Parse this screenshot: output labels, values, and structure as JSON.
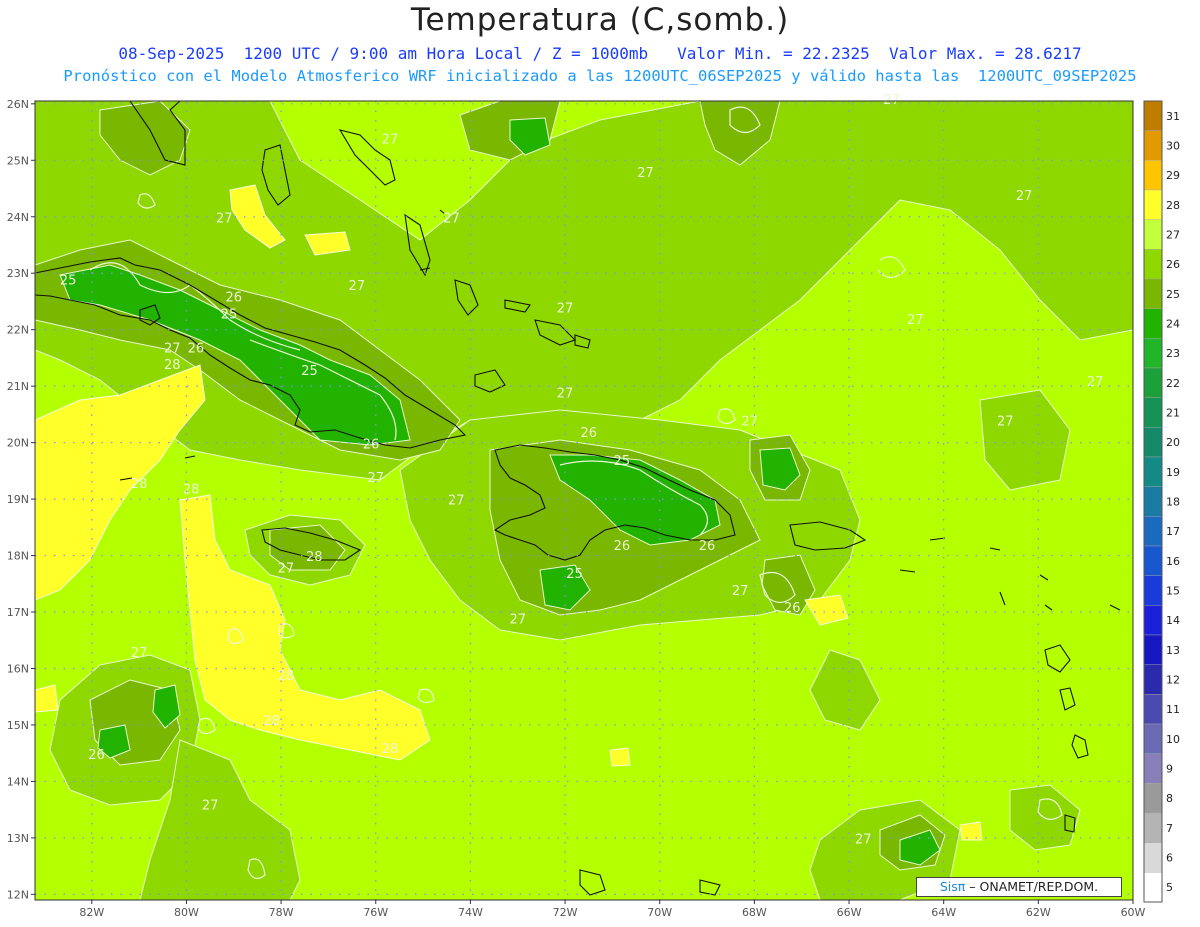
{
  "title": "Temperatura (C,somb.)",
  "subtitle_line1": "08-Sep-2025  1200 UTC / 9:00 am Hora Local / Z = 1000mb   Valor Min. = 22.2325  Valor Max. = 28.6217",
  "subtitle_line2": "Pronóstico con el Modelo Atmosferico WRF inicializado a las 1200UTC_06SEP2025 y válido hasta las  1200UTC_09SEP2025",
  "map": {
    "lat_ticks": [
      "26N",
      "25N",
      "24N",
      "23N",
      "22N",
      "21N",
      "20N",
      "19N",
      "18N",
      "17N",
      "16N",
      "15N",
      "14N",
      "13N",
      "12N"
    ],
    "lon_ticks": [
      "82W",
      "80W",
      "78W",
      "76W",
      "74W",
      "72W",
      "70W",
      "68W",
      "66W",
      "64W",
      "62W",
      "60W"
    ],
    "lat_values": [
      26,
      25,
      24,
      23,
      22,
      21,
      20,
      19,
      18,
      17,
      16,
      15,
      14,
      13,
      12
    ],
    "lon_values": [
      -82,
      -80,
      -78,
      -76,
      -74,
      -72,
      -70,
      -68,
      -66,
      -64,
      -62,
      -60
    ],
    "extent": {
      "lon_min": -83.2,
      "lon_max": -60,
      "lat_min": 11.9,
      "lat_max": 26.05
    },
    "contour_labels": [
      {
        "text": "25",
        "lon": -82.5,
        "lat": 22.8
      },
      {
        "text": "26",
        "lon": -79.0,
        "lat": 22.5
      },
      {
        "text": "25",
        "lon": -79.1,
        "lat": 22.2
      },
      {
        "text": "27",
        "lon": -76.4,
        "lat": 22.7
      },
      {
        "text": "27",
        "lon": -80.3,
        "lat": 21.6
      },
      {
        "text": "26",
        "lon": -79.8,
        "lat": 21.6
      },
      {
        "text": "28",
        "lon": -80.3,
        "lat": 21.3
      },
      {
        "text": "25",
        "lon": -77.4,
        "lat": 21.2
      },
      {
        "text": "26",
        "lon": -76.1,
        "lat": 19.9
      },
      {
        "text": "27",
        "lon": -76.0,
        "lat": 19.3
      },
      {
        "text": "28",
        "lon": -81.0,
        "lat": 19.2
      },
      {
        "text": "28",
        "lon": -79.9,
        "lat": 19.1
      },
      {
        "text": "27",
        "lon": -74.3,
        "lat": 18.9
      },
      {
        "text": "26",
        "lon": -71.5,
        "lat": 20.1
      },
      {
        "text": "25",
        "lon": -70.8,
        "lat": 19.6
      },
      {
        "text": "27",
        "lon": -72.0,
        "lat": 20.8
      },
      {
        "text": "27",
        "lon": -72.0,
        "lat": 22.3
      },
      {
        "text": "27",
        "lon": -74.4,
        "lat": 23.9
      },
      {
        "text": "27",
        "lon": -75.7,
        "lat": 25.3
      },
      {
        "text": "27",
        "lon": -70.3,
        "lat": 24.7
      },
      {
        "text": "27",
        "lon": -79.2,
        "lat": 23.9
      },
      {
        "text": "27",
        "lon": -65.1,
        "lat": 26.0
      },
      {
        "text": "27",
        "lon": -64.6,
        "lat": 22.1
      },
      {
        "text": "27",
        "lon": -62.3,
        "lat": 24.3
      },
      {
        "text": "27",
        "lon": -60.8,
        "lat": 21.0
      },
      {
        "text": "27",
        "lon": -62.7,
        "lat": 20.3
      },
      {
        "text": "27",
        "lon": -68.1,
        "lat": 20.3
      },
      {
        "text": "26",
        "lon": -70.8,
        "lat": 18.1
      },
      {
        "text": "26",
        "lon": -69.0,
        "lat": 18.1
      },
      {
        "text": "25",
        "lon": -71.8,
        "lat": 17.6
      },
      {
        "text": "27",
        "lon": -68.3,
        "lat": 17.3
      },
      {
        "text": "26",
        "lon": -67.2,
        "lat": 17.0
      },
      {
        "text": "27",
        "lon": -73.0,
        "lat": 16.8
      },
      {
        "text": "28",
        "lon": -77.3,
        "lat": 17.9
      },
      {
        "text": "27",
        "lon": -77.9,
        "lat": 17.7
      },
      {
        "text": "27",
        "lon": -81.0,
        "lat": 16.2
      },
      {
        "text": "28",
        "lon": -77.9,
        "lat": 15.8
      },
      {
        "text": "28",
        "lon": -78.2,
        "lat": 15.0
      },
      {
        "text": "28",
        "lon": -75.7,
        "lat": 14.5
      },
      {
        "text": "26",
        "lon": -81.9,
        "lat": 14.4
      },
      {
        "text": "27",
        "lon": -79.5,
        "lat": 13.5
      },
      {
        "text": "27",
        "lon": -65.7,
        "lat": 12.9
      }
    ]
  },
  "colorbar": {
    "levels": [
      "31",
      "30",
      "29",
      "28",
      "27",
      "26",
      "25",
      "24",
      "23",
      "22",
      "21",
      "20",
      "19",
      "18",
      "17",
      "16",
      "15",
      "14",
      "13",
      "12",
      "11",
      "10",
      "9",
      "8",
      "7",
      "6",
      "5"
    ],
    "colors": [
      "#bf7d00",
      "#e39a00",
      "#ffc600",
      "#ffff2a",
      "#c4ff3c",
      "#8ed800",
      "#79b700",
      "#22b300",
      "#21b52a",
      "#1ca13a",
      "#179257",
      "#148a6b",
      "#148a87",
      "#1a7ba3",
      "#1a6ac0",
      "#1857cf",
      "#1a3bd9",
      "#1a1fd8",
      "#1617c0",
      "#2a2aad",
      "#4a4ab0",
      "#6a6ab5",
      "#8a80b9",
      "#9a9a9a",
      "#b4b4b4",
      "#d9d9d9",
      "#ffffff"
    ]
  },
  "credit": {
    "brand": "Sisπ",
    "text": "– ONAMET/REP.DOM."
  }
}
